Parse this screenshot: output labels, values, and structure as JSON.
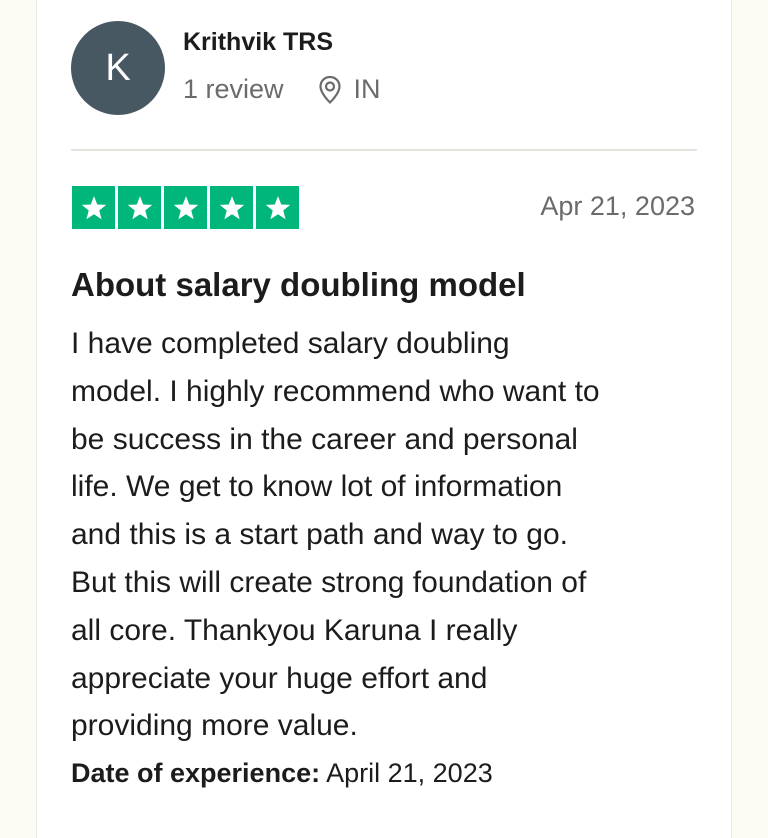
{
  "reviewer": {
    "avatar_initial": "K",
    "avatar_color": "#485863",
    "name": "Krithvik TRS",
    "review_count": "1 review",
    "location_icon": "location-pin-icon",
    "country": "IN"
  },
  "rating": {
    "stars": 5,
    "max": 5,
    "star_color": "#00b67a",
    "star_icon": "star-icon"
  },
  "review": {
    "date": "Apr 21, 2023",
    "title": "About salary doubling model",
    "body_lines": [
      "I have completed salary doubling",
      "model. I highly recommend who want to",
      "be success in the career and personal",
      "life. We get to know lot of information",
      "and this is a start path and way to go.",
      "But this will create strong foundation of",
      "all core. Thankyou Karuna I really",
      "appreciate your huge effort and",
      "providing more value."
    ],
    "experience_label": "Date of experience:",
    "experience_date": "April 21, 2023"
  }
}
